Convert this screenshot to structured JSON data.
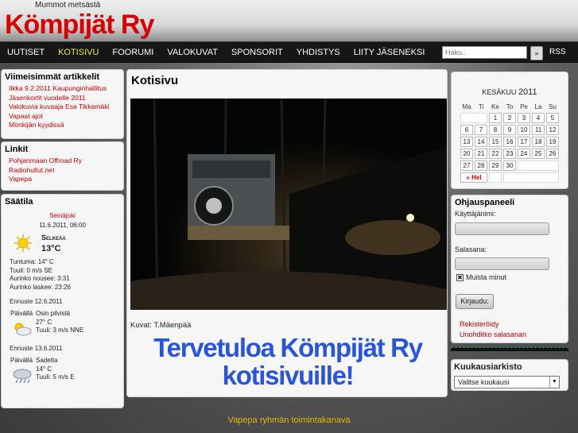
{
  "header": {
    "tagline": "Mummot metsästä",
    "logo": "Kömpijät Ry"
  },
  "nav": {
    "items": [
      "UUTISET",
      "KOTISIVU",
      "FOORUMI",
      "VALOKUVAT",
      "SPONSORIT",
      "YHDISTYS",
      "LIITY JÄSENEKSI"
    ],
    "active": "KOTISIVU",
    "search_placeholder": "Haku..",
    "search_button": "»",
    "rss": "RSS"
  },
  "articles": {
    "title": "Viimeisimmät artikkelit",
    "items": [
      "Ilkka 9.2.2011 Kaupunginhallitus",
      "Jäsenkortit vuodelle 2011",
      "Valokuvia kuvaaja Esa Tikkamäki",
      "Vapaat ajot",
      "Mönkijän kyydissä"
    ]
  },
  "links": {
    "title": "Linkit",
    "items": [
      "Pohjanmaan Offroad Ry",
      "Radiohullut.net",
      "Vapepa"
    ]
  },
  "weather": {
    "title": "Säätila",
    "city": "Seinäjoki",
    "time": "11.6.2011, 06:00",
    "condition": "Selkeää",
    "temp": "13°C",
    "feels": "Tuntuma: 14° C",
    "wind": "Tuuli: 0 m/s SE",
    "sunrise": "Aurinko nousee: 3:31",
    "sunset": "Aurinko laskee: 23:26",
    "forecast1_title": "Ennuste 12.6.2011",
    "forecast1_label": "Päivällä",
    "forecast1_desc": "Osin pilvistä",
    "forecast1_temp": "27° C",
    "forecast1_wind": "Tuuli: 3 m/s NNE",
    "forecast2_title": "Ennuste 13.6.2011",
    "forecast2_label": "Päivällä",
    "forecast2_desc": "Sadetta",
    "forecast2_temp": "14° C",
    "forecast2_wind": "Tuuli: 5 m/s E"
  },
  "main": {
    "heading": "Kotisivu",
    "caption": "Kuvat: T.Mäenpää",
    "welcome": "Tervetuloa Kömpijät Ry kotisivuille!"
  },
  "calendar": {
    "month": "KESÄKUU",
    "year": "2011",
    "weekdays": [
      "Ma",
      "Ti",
      "Ke",
      "To",
      "Pe",
      "La",
      "Su"
    ],
    "weeks": [
      [
        "",
        "",
        "1",
        "2",
        "3",
        "4",
        "5"
      ],
      [
        "6",
        "7",
        "8",
        "9",
        "10",
        "11",
        "12"
      ],
      [
        "13",
        "14",
        "15",
        "16",
        "17",
        "18",
        "19"
      ],
      [
        "20",
        "21",
        "22",
        "23",
        "24",
        "25",
        "26"
      ],
      [
        "27",
        "28",
        "29",
        "30",
        "",
        "",
        ""
      ]
    ],
    "prev": "« Hel"
  },
  "login": {
    "title": "Ohjauspaneeli",
    "username_label": "Käyttäjänimi:",
    "password_label": "Salasana:",
    "remember": "Muista minut",
    "button": "Kirjaudu:",
    "register": "Rekisteröidy",
    "forgot": "Unohditko salasanan"
  },
  "archive": {
    "title": "Kuukausiarkisto",
    "select": "Valitse kuukausi"
  },
  "footer": {
    "text": "Vapepa ryhmän toimintakanava"
  }
}
